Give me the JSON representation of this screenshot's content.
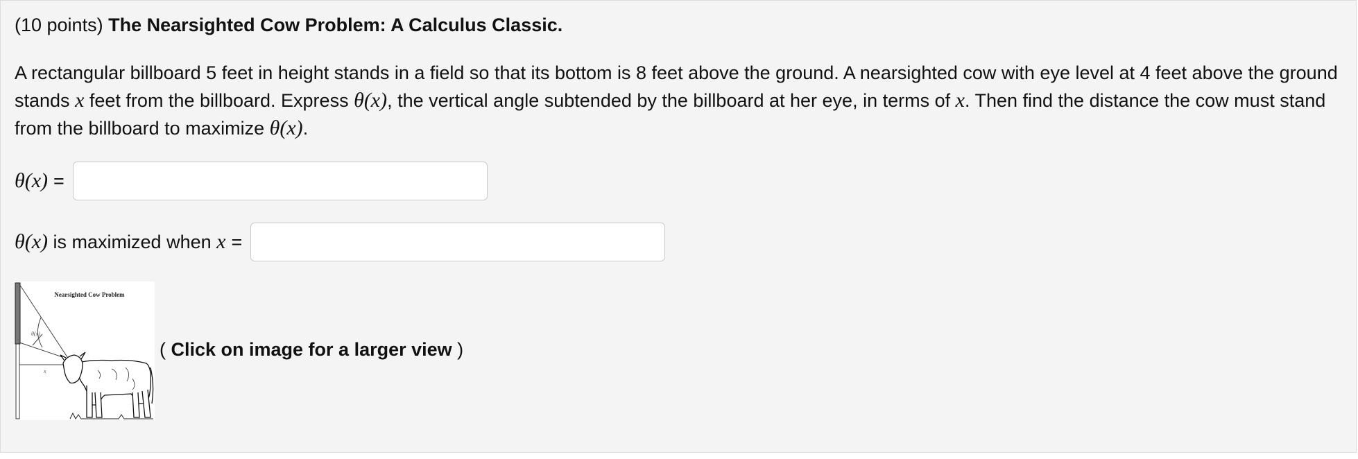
{
  "problem": {
    "points": "(10 points)",
    "title": "The Nearsighted Cow Problem: A Calculus Classic.",
    "statement": {
      "part1": "A rectangular billboard 5 feet in height stands in a field so that its bottom is 8 feet above the ground. A nearsighted cow with eye level at 4 feet above the ground stands ",
      "x1": "x",
      "part2": " feet from the billboard. Express ",
      "theta_x1": "θ(x)",
      "part3": ", the vertical angle subtended by the billboard at her eye, in terms of ",
      "x2": "x",
      "part4": ". Then find the distance the cow must stand from the billboard to maximize ",
      "theta_x2": "θ(x)",
      "part5": "."
    }
  },
  "answers": [
    {
      "math_label": "θ(x)",
      "text_label": "",
      "math_var": "",
      "equals": "=",
      "value": "",
      "placeholder": ""
    },
    {
      "math_label": "θ(x)",
      "text_label": " is maximized when ",
      "math_var": "x",
      "equals": "=",
      "value": "",
      "placeholder": ""
    }
  ],
  "figure": {
    "title": "Nearsighted Cow Problem",
    "angle_label": "θ(x)",
    "distance_label": "x",
    "caption_open": "( ",
    "caption_text": "Click on image for a larger view",
    "caption_close": " )"
  }
}
